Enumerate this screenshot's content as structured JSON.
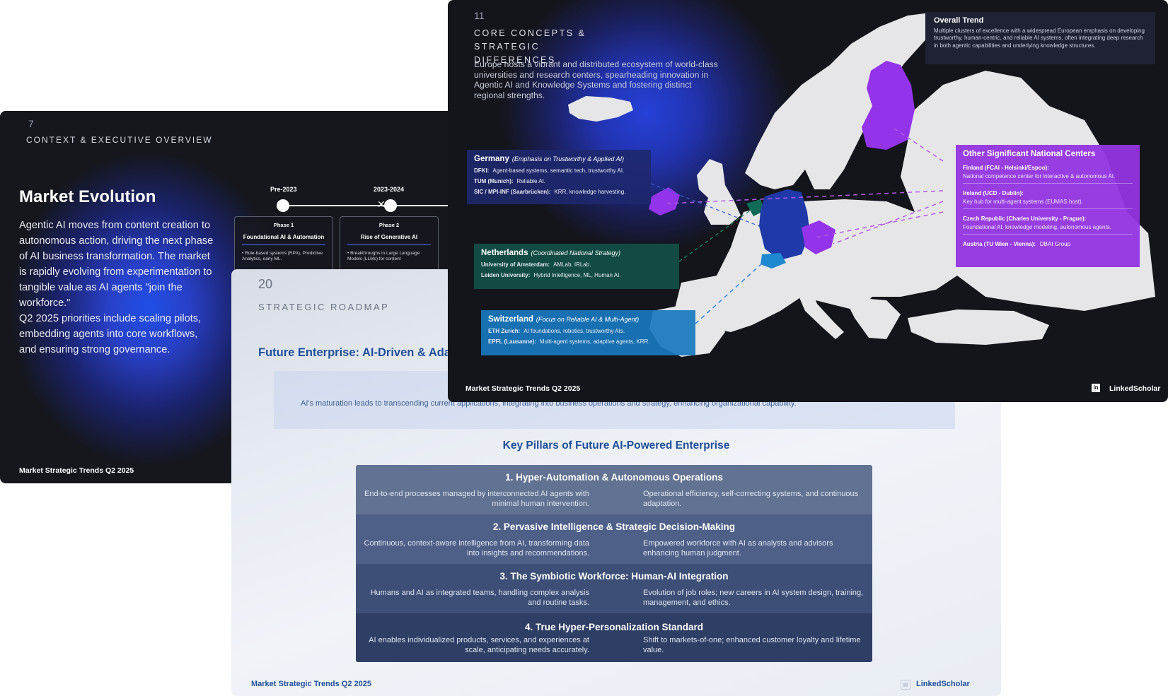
{
  "slide7": {
    "number": "7",
    "kicker": "CONTEXT & EXECUTIVE OVERVIEW",
    "title": "Market Evolution",
    "body": "Agentic AI moves from content creation to autonomous action, driving the next phase of AI business transformation. The market is rapidly evolving from experimentation to tangible value as AI agents \"join the workforce.\"\nQ2 2025 priorities include scaling pilots, embedding agents into core workflows, and ensuring strong governance.",
    "timeline": [
      {
        "label": "Pre-2023",
        "phase": "Phase 1",
        "name": "Foundational AI & Automation",
        "text": "• Rule-based systems (RPA), Predictive Analytics, early ML."
      },
      {
        "label": "2023-2024",
        "phase": "Phase 2",
        "name": "Rise of Generative AI",
        "text": "• Breakthroughs in Large Language Models (LLMs) for content"
      }
    ],
    "footer": "Market Strategic Trends Q2 2025"
  },
  "slide20": {
    "number": "20",
    "kicker": "STRATEGIC ROADMAP",
    "headline": "Future Enterprise: AI-Driven & Ada",
    "banner": "AI's maturation leads to transcending current applications, integrating into business operations and strategy, enhancing organizational capability.",
    "pillars_title": "Key Pillars of Future AI-Powered Enterprise",
    "pillars": [
      {
        "title": "1. Hyper-Automation & Autonomous Operations",
        "left": "End-to-end processes managed by interconnected AI agents with minimal human intervention.",
        "right": "Operational efficiency, self-correcting systems, and continuous adaptation.",
        "color": "#627292"
      },
      {
        "title": "2. Pervasive Intelligence & Strategic Decision-Making",
        "left": "Continuous, context-aware intelligence from AI, transforming data into insights and recommendations.",
        "right": "Empowered workforce with AI as analysts and advisors enhancing human judgment.",
        "color": "#4f6088"
      },
      {
        "title": "3. The Symbiotic Workforce: Human-AI Integration",
        "left": "Humans and AI as integrated teams, handling complex analysis and routine tasks.",
        "right": "Evolution of job roles; new careers in AI system design, training, management, and ethics.",
        "color": "#3e4f77"
      },
      {
        "title": "4. True Hyper-Personalization Standard",
        "left": "AI enables individualized products, services, and experiences at scale, anticipating needs accurately.",
        "right": "Shift to markets-of-one; enhanced customer loyalty and lifetime value.",
        "color": "#2f3e64"
      }
    ],
    "footer": "Market Strategic Trends Q2 2025",
    "brand": "LinkedScholar"
  },
  "slide11": {
    "number": "11",
    "kicker": "CORE CONCEPTS & STRATEGIC DIFFERENCES",
    "intro": "Europe hosts a vibrant and distributed ecosystem of world-class universities and research centers, spearheading innovation in Agentic AI and Knowledge Systems and fostering distinct regional strengths.",
    "trend": {
      "title": "Overall Trend",
      "text": "Multiple clusters of excellence with a widespread European emphasis on developing trustworthy, human-centric, and reliable AI systems, often integrating deep research in both agentic capabilities and underlying knowledge structures."
    },
    "germany": {
      "country": "Germany",
      "note": "(Emphasis on Trustworthy & Applied AI)",
      "rows": [
        {
          "name": "DFKI:",
          "desc": "Agent-based systems, semantic tech, trustworthy AI."
        },
        {
          "name": "TUM (Munich):",
          "desc": "Reliable AI."
        },
        {
          "name": "SIC / MPI-INF (Saarbrücken):",
          "desc": "KRR, knowledge harvesting."
        }
      ]
    },
    "netherlands": {
      "country": "Netherlands",
      "note": "(Coordinated National Strategy)",
      "rows": [
        {
          "name": "University of Amsterdam:",
          "desc": "AMLab, IRLab."
        },
        {
          "name": "Leiden University:",
          "desc": "Hybrid Intelligence, ML, Human AI."
        }
      ]
    },
    "switzerland": {
      "country": "Switzerland",
      "note": "(Focus on Reliable AI & Multi-Agent)",
      "rows": [
        {
          "name": "ETH Zurich:",
          "desc": "AI foundations, robotics, trustworthy AIs."
        },
        {
          "name": "EPFL (Lausanne):",
          "desc": "Multi-agent systems, adaptive agents, KRR."
        }
      ]
    },
    "other": {
      "title": "Other Significant National Centers",
      "finland_name": "Finland (FCAI - Helsinki/Espoo):",
      "finland_desc": "National competence center for interactive & autonomous AI.",
      "ireland_name": "Ireland (UCD - Dublin):",
      "ireland_desc": "Key hub for multi-agent systems (EUMAS host).",
      "czech_name": "Czech Republic (Charles University - Prague):",
      "czech_desc": "Foundational AI, knowledge modeling, autonomous agents.",
      "austria_name": "Austria (TU Wien - Vienna):",
      "austria_desc": "DBAI Group"
    },
    "colors": {
      "germany": "#1f3aa8",
      "netherlands": "#0f6b55",
      "switzerland": "#1e88d0",
      "highlight": "#9333ea",
      "land": "#e6e6e8"
    },
    "footer": "Market Strategic Trends Q2 2025",
    "brand": "LinkedScholar",
    "brand_icon": "in"
  }
}
